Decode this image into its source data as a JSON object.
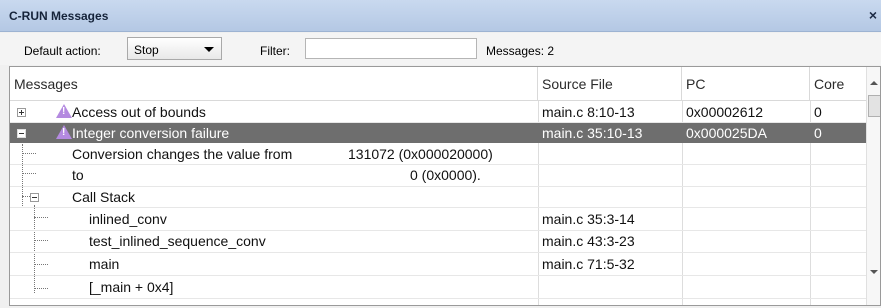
{
  "window": {
    "title": "C-RUN Messages",
    "close_glyph": "×"
  },
  "toolbar": {
    "default_action_label": "Default action:",
    "default_action_value": "Stop",
    "filter_label": "Filter:",
    "filter_value": "",
    "filter_placeholder": "",
    "messages_count": "Messages: 2"
  },
  "table": {
    "columns": [
      "Messages",
      "Source File",
      "PC",
      "Core"
    ],
    "rows": [
      {
        "message": "Access out of bounds",
        "source": "main.c 8:10-13",
        "pc": "0x00002612",
        "core": "0"
      },
      {
        "message": "Integer conversion failure",
        "source": "main.c 35:10-13",
        "pc": "0x000025DA",
        "core": "0"
      },
      {
        "message": "Conversion changes the value from",
        "value": "131072 (0x000020000)"
      },
      {
        "message": "to",
        "value": "0 (0x0000)."
      },
      {
        "message": "Call Stack"
      },
      {
        "message": "inlined_conv",
        "source": "main.c 35:3-14"
      },
      {
        "message": "test_inlined_sequence_conv",
        "source": "main.c 43:3-23"
      },
      {
        "message": "main",
        "source": "main.c 71:5-32"
      },
      {
        "message": "[_main + 0x4]"
      }
    ]
  },
  "icons": {
    "warning": "warning-icon",
    "expand": "plus-icon",
    "collapse": "minus-icon"
  },
  "colors": {
    "selected_row": "#6e6e6e",
    "titlebar": "#c9d9ef",
    "warning": "#b48ae0"
  }
}
